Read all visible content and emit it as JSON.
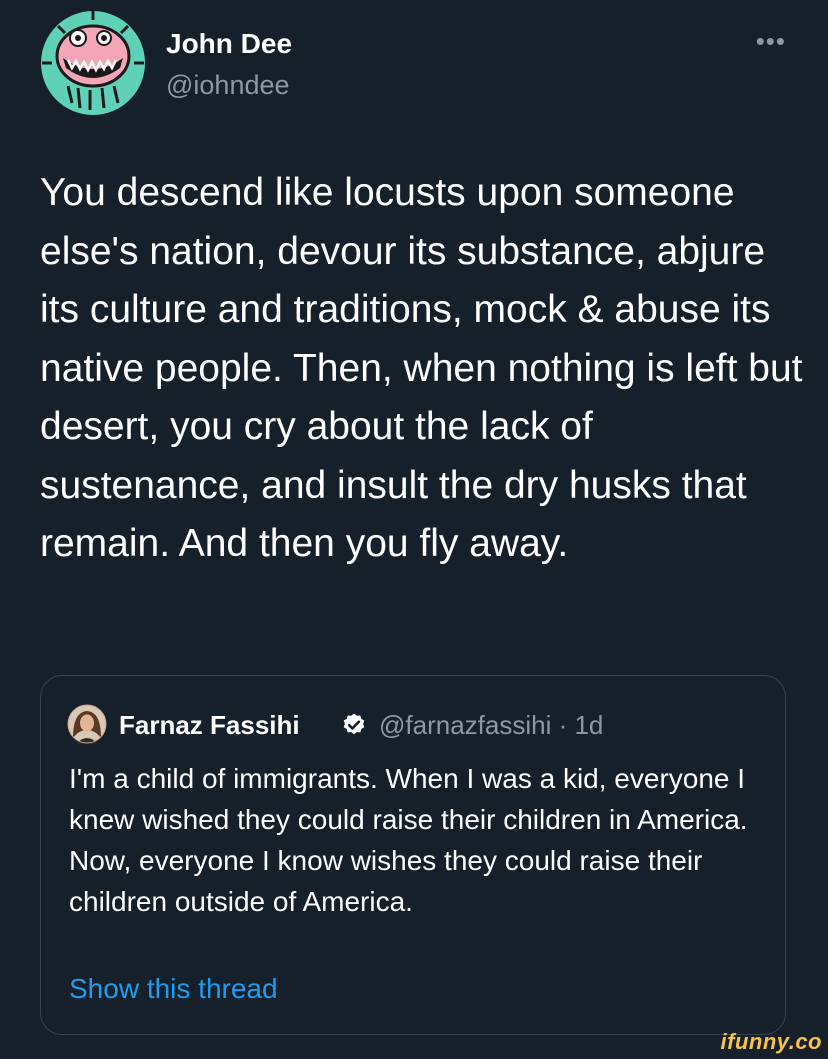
{
  "tweet": {
    "author": {
      "name": "John Dee",
      "handle": "@iohndee"
    },
    "more_icon": "ellipsis-icon",
    "text": "You descend like locusts upon someone else's nation, devour its substance, abjure its culture and traditions, mock & abuse its native people. Then, when nothing is left but desert, you cry about the lack of sustenance, and insult the dry husks that remain. And then you fly away."
  },
  "quoted_tweet": {
    "author": {
      "name": "Farnaz Fassihi",
      "verified_icon": "verified-badge-icon",
      "handle_time": "@farnazfassihi · 1d"
    },
    "text": "I'm a child of immigrants. When I was a kid, everyone I knew wished they could raise their children in America. Now, everyone I know wishes they could raise their children outside of America.",
    "show_thread_label": "Show this thread"
  },
  "watermark": "ifunny.co",
  "colors": {
    "background": "#15202b",
    "text_primary": "#ffffff",
    "text_secondary": "#8b98a5",
    "link": "#1d9bf0",
    "border": "#38444d",
    "avatar_ring": "#5fd1b6",
    "avatar_face": "#f4a6b8",
    "watermark": "#f6c344"
  }
}
